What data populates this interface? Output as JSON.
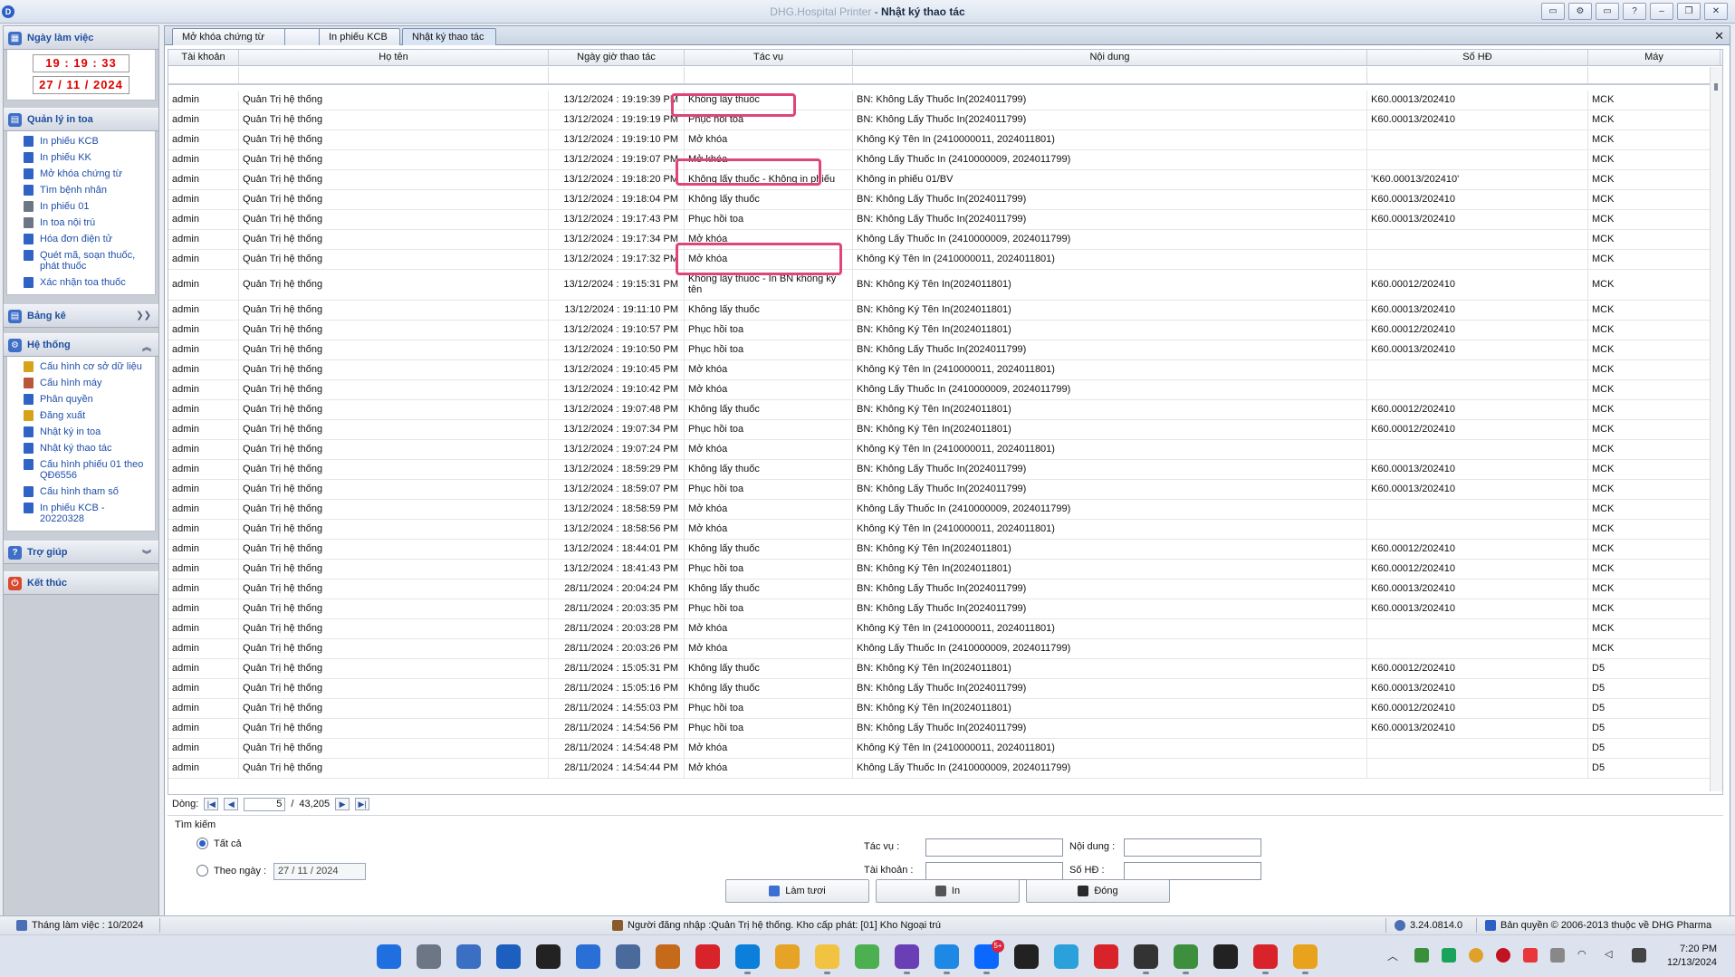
{
  "window": {
    "app_prefix": "DHG.Hospital Printer",
    "title_sep": " - ",
    "title": "Nhật ký thao tác",
    "buttons": [
      "▭",
      "⚙",
      "▭",
      "?",
      "–",
      "❐",
      "✕"
    ]
  },
  "sidebar": {
    "workday_title": "Ngày làm việc",
    "clock_time": "19 : 19 : 33",
    "clock_date": "27 / 11 / 2024",
    "sections": [
      {
        "title": "Quản lý in toa",
        "items": [
          "In phiếu KCB",
          "In phiếu KK",
          "Mở khóa chứng từ",
          "Tìm bệnh nhân",
          "In phiếu 01",
          "In toa nội trú",
          "Hóa đơn điện tử",
          "Quét mã, soạn thuốc, phát thuốc",
          "Xác nhận toa thuốc"
        ]
      },
      {
        "title": "Bảng kê",
        "items": []
      },
      {
        "title": "Hệ thống",
        "items": [
          "Cấu hình cơ sở dữ liệu",
          "Cấu hình máy",
          "Phân quyền",
          "Đăng xuất",
          "Nhật ký in toa",
          "Nhật ký thao tác",
          "Cấu hình phiếu 01 theo QĐ6556",
          "Cấu hình tham số",
          "In phiếu KCB - 20220328"
        ]
      },
      {
        "title": "Trợ giúp",
        "items": []
      },
      {
        "title": "Kết thúc",
        "items": []
      }
    ]
  },
  "tabs": [
    {
      "label": "Mở khóa chứng từ"
    },
    {
      "label": ""
    },
    {
      "label": "In phiếu KCB"
    },
    {
      "label": "Nhật ký thao tác"
    }
  ],
  "grid": {
    "columns": [
      "Tài khoản",
      "Họ tên",
      "Ngày giờ thao tác",
      "Tác vụ",
      "Nội dung",
      "Số HĐ",
      "Máy"
    ],
    "rows": [
      [
        "admin",
        "Quản Trị hệ thống",
        "13/12/2024 : 19:19:39 PM",
        "Không lấy thuốc",
        "BN: Không Lấy Thuốc In(2024011799)",
        "K60.00013/202410",
        "MCK"
      ],
      [
        "admin",
        "Quản Trị hệ thống",
        "13/12/2024 : 19:19:19 PM",
        "Phục hồi toa",
        "BN: Không Lấy Thuốc In(2024011799)",
        "K60.00013/202410",
        "MCK"
      ],
      [
        "admin",
        "Quản Trị hệ thống",
        "13/12/2024 : 19:19:10 PM",
        "Mở khóa",
        "Không Ký Tên In (2410000011, 2024011801)",
        "",
        "MCK"
      ],
      [
        "admin",
        "Quản Trị hệ thống",
        "13/12/2024 : 19:19:07 PM",
        "Mở khóa",
        "Không Lấy Thuốc In (2410000009, 2024011799)",
        "",
        "MCK"
      ],
      [
        "admin",
        "Quản Trị hệ thống",
        "13/12/2024 : 19:18:20 PM",
        "Không lấy thuốc - Không in phiếu",
        "Không in phiếu 01/BV",
        "'K60.00013/202410'",
        "MCK"
      ],
      [
        "admin",
        "Quản Trị hệ thống",
        "13/12/2024 : 19:18:04 PM",
        "Không lấy thuốc",
        "BN: Không Lấy Thuốc In(2024011799)",
        "K60.00013/202410",
        "MCK"
      ],
      [
        "admin",
        "Quản Trị hệ thống",
        "13/12/2024 : 19:17:43 PM",
        "Phục hồi toa",
        "BN: Không Lấy Thuốc In(2024011799)",
        "K60.00013/202410",
        "MCK"
      ],
      [
        "admin",
        "Quản Trị hệ thống",
        "13/12/2024 : 19:17:34 PM",
        "Mở khóa",
        "Không Lấy Thuốc In (2410000009, 2024011799)",
        "",
        "MCK"
      ],
      [
        "admin",
        "Quản Trị hệ thống",
        "13/12/2024 : 19:17:32 PM",
        "Mở khóa",
        "Không Ký Tên In (2410000011, 2024011801)",
        "",
        "MCK"
      ],
      [
        "admin",
        "Quản Trị hệ thống",
        "13/12/2024 : 19:15:31 PM",
        "Không lấy thuốc - In BN không ký tên",
        "BN: Không Ký Tên In(2024011801)",
        "K60.00012/202410",
        "MCK"
      ],
      [
        "admin",
        "Quản Trị hệ thống",
        "13/12/2024 : 19:11:10 PM",
        "Không lấy thuốc",
        "BN: Không Ký Tên In(2024011801)",
        "K60.00013/202410",
        "MCK"
      ],
      [
        "admin",
        "Quản Trị hệ thống",
        "13/12/2024 : 19:10:57 PM",
        "Phục hồi toa",
        "BN: Không Ký Tên In(2024011801)",
        "K60.00012/202410",
        "MCK"
      ],
      [
        "admin",
        "Quản Trị hệ thống",
        "13/12/2024 : 19:10:50 PM",
        "Phục hồi toa",
        "BN: Không Lấy Thuốc In(2024011799)",
        "K60.00013/202410",
        "MCK"
      ],
      [
        "admin",
        "Quản Trị hệ thống",
        "13/12/2024 : 19:10:45 PM",
        "Mở khóa",
        "Không Ký Tên In (2410000011, 2024011801)",
        "",
        "MCK"
      ],
      [
        "admin",
        "Quản Trị hệ thống",
        "13/12/2024 : 19:10:42 PM",
        "Mở khóa",
        "Không Lấy Thuốc In (2410000009, 2024011799)",
        "",
        "MCK"
      ],
      [
        "admin",
        "Quản Trị hệ thống",
        "13/12/2024 : 19:07:48 PM",
        "Không lấy thuốc",
        "BN: Không Ký Tên In(2024011801)",
        "K60.00012/202410",
        "MCK"
      ],
      [
        "admin",
        "Quản Trị hệ thống",
        "13/12/2024 : 19:07:34 PM",
        "Phục hồi toa",
        "BN: Không Ký Tên In(2024011801)",
        "K60.00012/202410",
        "MCK"
      ],
      [
        "admin",
        "Quản Trị hệ thống",
        "13/12/2024 : 19:07:24 PM",
        "Mở khóa",
        "Không Ký Tên In (2410000011, 2024011801)",
        "",
        "MCK"
      ],
      [
        "admin",
        "Quản Trị hệ thống",
        "13/12/2024 : 18:59:29 PM",
        "Không lấy thuốc",
        "BN: Không Lấy Thuốc In(2024011799)",
        "K60.00013/202410",
        "MCK"
      ],
      [
        "admin",
        "Quản Trị hệ thống",
        "13/12/2024 : 18:59:07 PM",
        "Phục hồi toa",
        "BN: Không Lấy Thuốc In(2024011799)",
        "K60.00013/202410",
        "MCK"
      ],
      [
        "admin",
        "Quản Trị hệ thống",
        "13/12/2024 : 18:58:59 PM",
        "Mở khóa",
        "Không Lấy Thuốc In (2410000009, 2024011799)",
        "",
        "MCK"
      ],
      [
        "admin",
        "Quản Trị hệ thống",
        "13/12/2024 : 18:58:56 PM",
        "Mở khóa",
        "Không Ký Tên In (2410000011, 2024011801)",
        "",
        "MCK"
      ],
      [
        "admin",
        "Quản Trị hệ thống",
        "13/12/2024 : 18:44:01 PM",
        "Không lấy thuốc",
        "BN: Không Ký Tên In(2024011801)",
        "K60.00012/202410",
        "MCK"
      ],
      [
        "admin",
        "Quản Trị hệ thống",
        "13/12/2024 : 18:41:43 PM",
        "Phục hồi toa",
        "BN: Không Ký Tên In(2024011801)",
        "K60.00012/202410",
        "MCK"
      ],
      [
        "admin",
        "Quản Trị hệ thống",
        "28/11/2024 : 20:04:24 PM",
        "Không lấy thuốc",
        "BN: Không Lấy Thuốc In(2024011799)",
        "K60.00013/202410",
        "MCK"
      ],
      [
        "admin",
        "Quản Trị hệ thống",
        "28/11/2024 : 20:03:35 PM",
        "Phục hồi toa",
        "BN: Không Lấy Thuốc In(2024011799)",
        "K60.00013/202410",
        "MCK"
      ],
      [
        "admin",
        "Quản Trị hệ thống",
        "28/11/2024 : 20:03:28 PM",
        "Mở khóa",
        "Không Ký Tên In (2410000011, 2024011801)",
        "",
        "MCK"
      ],
      [
        "admin",
        "Quản Trị hệ thống",
        "28/11/2024 : 20:03:26 PM",
        "Mở khóa",
        "Không Lấy Thuốc In (2410000009, 2024011799)",
        "",
        "MCK"
      ],
      [
        "admin",
        "Quản Trị hệ thống",
        "28/11/2024 : 15:05:31 PM",
        "Không lấy thuốc",
        "BN: Không Ký Tên In(2024011801)",
        "K60.00012/202410",
        "D5"
      ],
      [
        "admin",
        "Quản Trị hệ thống",
        "28/11/2024 : 15:05:16 PM",
        "Không lấy thuốc",
        "BN: Không Lấy Thuốc In(2024011799)",
        "K60.00013/202410",
        "D5"
      ],
      [
        "admin",
        "Quản Trị hệ thống",
        "28/11/2024 : 14:55:03 PM",
        "Phục hồi toa",
        "BN: Không Ký Tên In(2024011801)",
        "K60.00012/202410",
        "D5"
      ],
      [
        "admin",
        "Quản Trị hệ thống",
        "28/11/2024 : 14:54:56 PM",
        "Phục hồi toa",
        "BN: Không Lấy Thuốc In(2024011799)",
        "K60.00013/202410",
        "D5"
      ],
      [
        "admin",
        "Quản Trị hệ thống",
        "28/11/2024 : 14:54:48 PM",
        "Mở khóa",
        "Không Ký Tên In (2410000011, 2024011801)",
        "",
        "D5"
      ],
      [
        "admin",
        "Quản Trị hệ thống",
        "28/11/2024 : 14:54:44 PM",
        "Mở khóa",
        "Không Lấy Thuốc In (2410000009, 2024011799)",
        "",
        "D5"
      ]
    ]
  },
  "pager": {
    "label": "Dòng:",
    "current": "5",
    "separator": "/",
    "total": "43,205"
  },
  "search": {
    "legend": "Tìm kiếm",
    "all_label": "Tất cả",
    "by_date_label": "Theo ngày :",
    "date_value": "27 / 11 / 2024",
    "task_label": "Tác vụ :",
    "content_label": "Nội dung :",
    "account_label": "Tài khoản :",
    "invoice_label": "Số HĐ :"
  },
  "actions": {
    "refresh": "Làm tươi",
    "print": "In",
    "close": "Đóng"
  },
  "status": {
    "work_month": "Tháng làm việc : 10/2024",
    "login_info": "Người đăng nhập :Quản Trị hệ thống. Kho cấp phát: [01] Kho Ngoại trú",
    "version": "3.24.0814.0",
    "copyright": "Bản quyền © 2006-2013 thuộc về DHG Pharma"
  },
  "taskbar": {
    "time": "7:20 PM",
    "date": "12/13/2024",
    "zalo_badge": "5+",
    "icons": [
      "windows-start",
      "settings",
      "search-tool",
      "photos",
      "terminal",
      "remote",
      "monitor",
      "chrome-alt",
      "app-s",
      "edge",
      "browser",
      "file-explorer",
      "notepad",
      "visual-studio",
      "vscode",
      "zalo",
      "chatgpt",
      "telegram",
      "app-star",
      "app-dark",
      "app-hospital",
      "cmd",
      "app-medical",
      "chrome"
    ]
  },
  "colors": {
    "highlight": "#e0457a",
    "link": "#1f4fa8",
    "clock": "#e00000"
  }
}
